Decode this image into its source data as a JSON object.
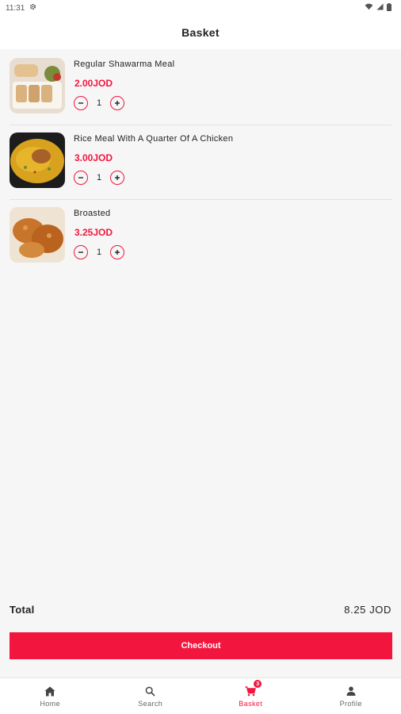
{
  "status_bar": {
    "time": "11:31",
    "icons": [
      "settings-icon",
      "wifi-icon",
      "signal-icon",
      "battery-icon"
    ]
  },
  "app_bar": {
    "title": "Basket"
  },
  "basket": {
    "items": [
      {
        "name": "Regular Shawarma Meal",
        "price": "2.00JOD",
        "quantity": "1",
        "image": "shawarma-meal-photo"
      },
      {
        "name": "Rice Meal With A Quarter Of A Chicken",
        "price": "3.00JOD",
        "quantity": "1",
        "image": "rice-chicken-photo"
      },
      {
        "name": "Broasted",
        "price": "3.25JOD",
        "quantity": "1",
        "image": "broasted-chicken-photo"
      }
    ]
  },
  "summary": {
    "total_label": "Total",
    "total_value": "8.25 JOD"
  },
  "checkout": {
    "label": "Checkout"
  },
  "bottom_nav": {
    "items": [
      {
        "label": "Home",
        "icon": "home-icon"
      },
      {
        "label": "Search",
        "icon": "search-icon"
      },
      {
        "label": "Basket",
        "icon": "cart-icon",
        "badge": "3",
        "active": true
      },
      {
        "label": "Profile",
        "icon": "person-icon"
      }
    ]
  },
  "colors": {
    "accent": "#f2163e",
    "background": "#f6f6f6",
    "surface": "#ffffff"
  }
}
